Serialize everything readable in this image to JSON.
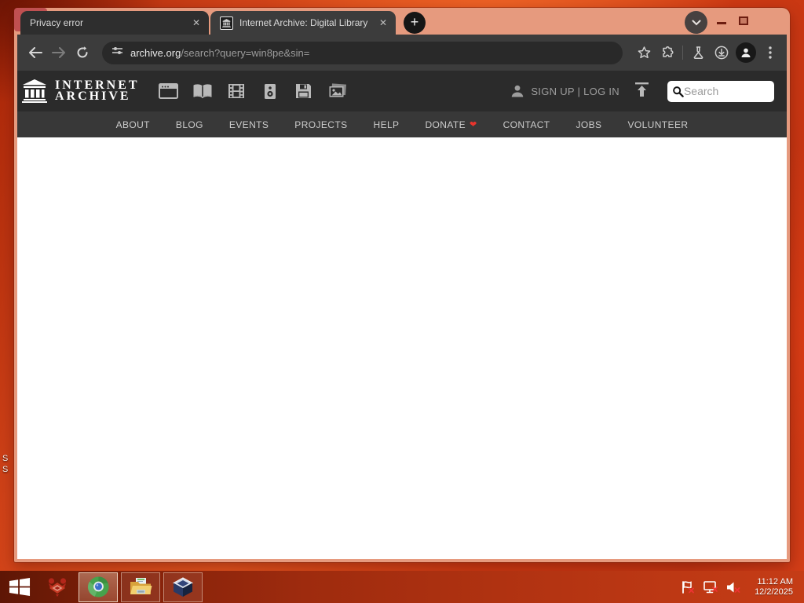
{
  "desktop": {
    "label_fragments": [
      "S",
      "S"
    ]
  },
  "browser": {
    "tabs": [
      {
        "title": "Privacy error",
        "active": false
      },
      {
        "title": "Internet Archive: Digital Library",
        "active": true
      }
    ],
    "new_tab_glyph": "+",
    "close_glyph": "✕",
    "address": {
      "domain": "archive.org",
      "path": "/search?query=win8pe&sin="
    }
  },
  "archive_header": {
    "logo": {
      "line1": "INTERNET",
      "line2": "ARCHIVE"
    },
    "media_types": [
      "web",
      "texts",
      "video",
      "audio",
      "software",
      "images"
    ],
    "auth": "SIGN UP | LOG IN",
    "search_placeholder": "Search",
    "donate_heart": "❤"
  },
  "nav": {
    "items": [
      "ABOUT",
      "BLOG",
      "EVENTS",
      "PROJECTS",
      "HELP",
      "DONATE",
      "CONTACT",
      "JOBS",
      "VOLUNTEER"
    ]
  },
  "taskbar": {
    "time": "11:12 AM",
    "date": "12/2/2025"
  },
  "colors": {
    "desktop_red": "#d04218",
    "window_frame_salmon": "#e69a7e",
    "toolbar_dark": "#3c3c3c",
    "tab_inactive": "#2e2e2e",
    "archive_header": "#2b2b2b",
    "archive_nav": "#383838",
    "close_button_red": "#c05051",
    "donate_heart_red": "#e8342c",
    "taskbar_red": "#9e2b0e"
  }
}
